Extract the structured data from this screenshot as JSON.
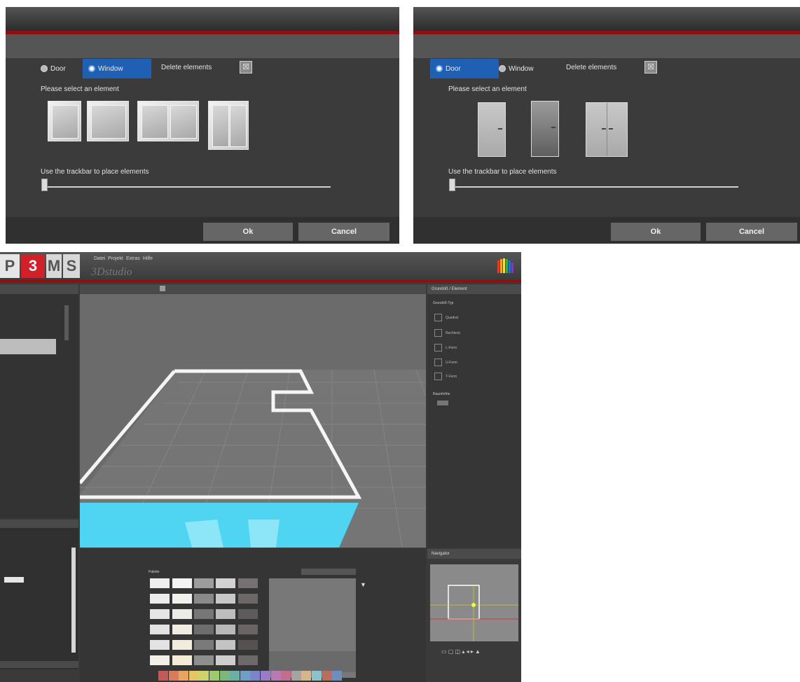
{
  "dialog_window": {
    "radio_door": "Door",
    "radio_window": "Window",
    "selected": "Window",
    "delete_label": "Delete elements",
    "prompt": "Please select an element",
    "track_label": "Use the trackbar to place elements",
    "ok": "Ok",
    "cancel": "Cancel"
  },
  "dialog_door": {
    "radio_door": "Door",
    "radio_window": "Window",
    "selected": "Door",
    "delete_label": "Delete elements",
    "prompt": "Please select an element",
    "track_label": "Use the trackbar to place elements",
    "ok": "Ok",
    "cancel": "Cancel"
  },
  "app": {
    "logo": [
      "P",
      "3",
      "M",
      "S"
    ],
    "subtitle": "3Dstudio",
    "menu": [
      "Datei",
      "Projekt",
      "Extras",
      "Hilfe"
    ],
    "right_panel_title": "Grundriß / Element",
    "right_panel_section": "Grundriß-Typ",
    "right_panel_items": [
      "Quadrat",
      "Rechteck",
      "L-Form",
      "U-Form",
      "T-Form"
    ],
    "right_panel_section2": "Raumhöhe",
    "nav_title": "Navigator",
    "palette_label": "Palette",
    "accent_blue": "#4fd4f2",
    "accent_red": "#8d1010"
  },
  "icons": {
    "delete": "close-box-icon",
    "app_logo": "color-fan-icon"
  }
}
